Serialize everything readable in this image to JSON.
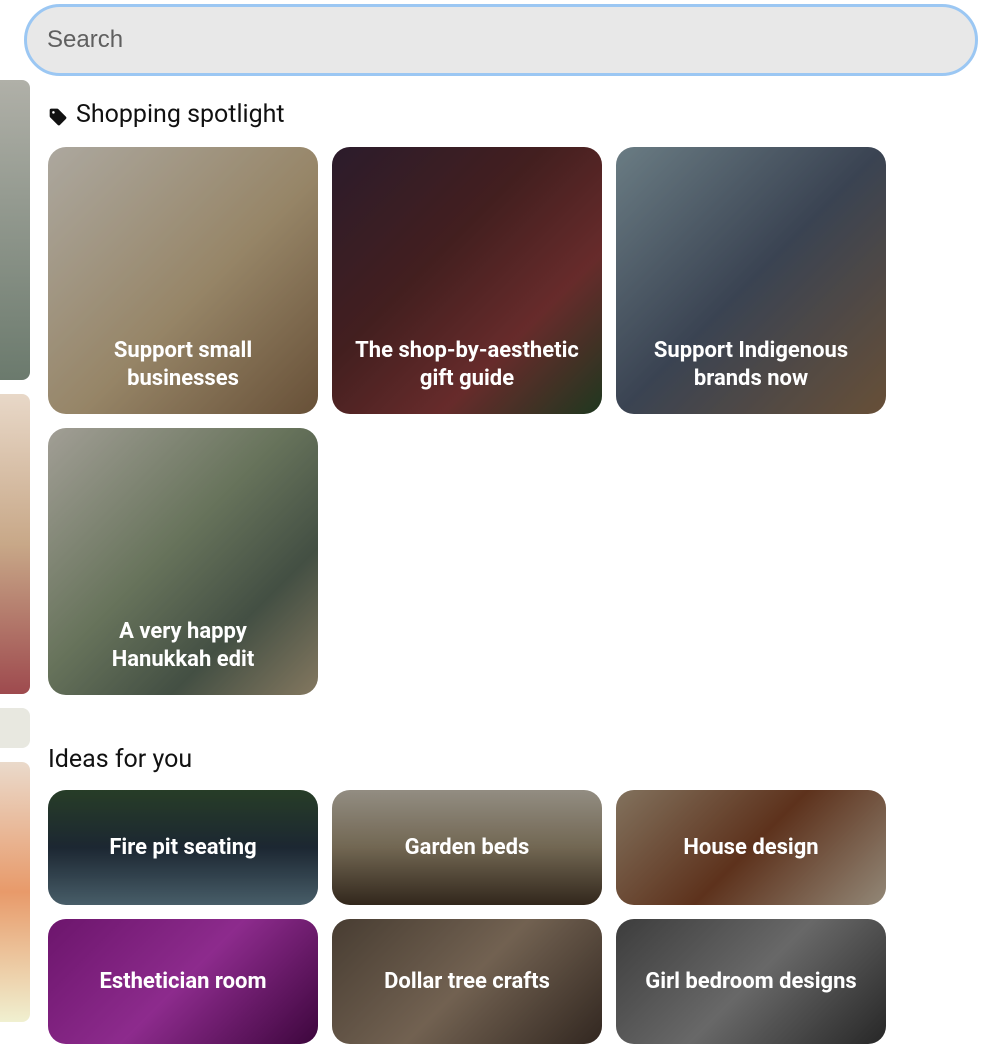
{
  "search": {
    "placeholder": "Search",
    "value": ""
  },
  "sections": {
    "spotlight": {
      "title": "Shopping spotlight",
      "tiles": [
        {
          "label": "Support small businesses"
        },
        {
          "label": "The shop-by-aesthetic gift guide"
        },
        {
          "label": "Support Indigenous brands now"
        },
        {
          "label": "A very happy Hanukkah edit"
        }
      ]
    },
    "ideas": {
      "title": "Ideas for you",
      "tiles": [
        {
          "label": "Fire pit seating"
        },
        {
          "label": "Garden beds"
        },
        {
          "label": "House design"
        },
        {
          "label": "Esthetician room"
        },
        {
          "label": "Dollar tree crafts"
        },
        {
          "label": "Girl bedroom designs"
        }
      ]
    }
  }
}
